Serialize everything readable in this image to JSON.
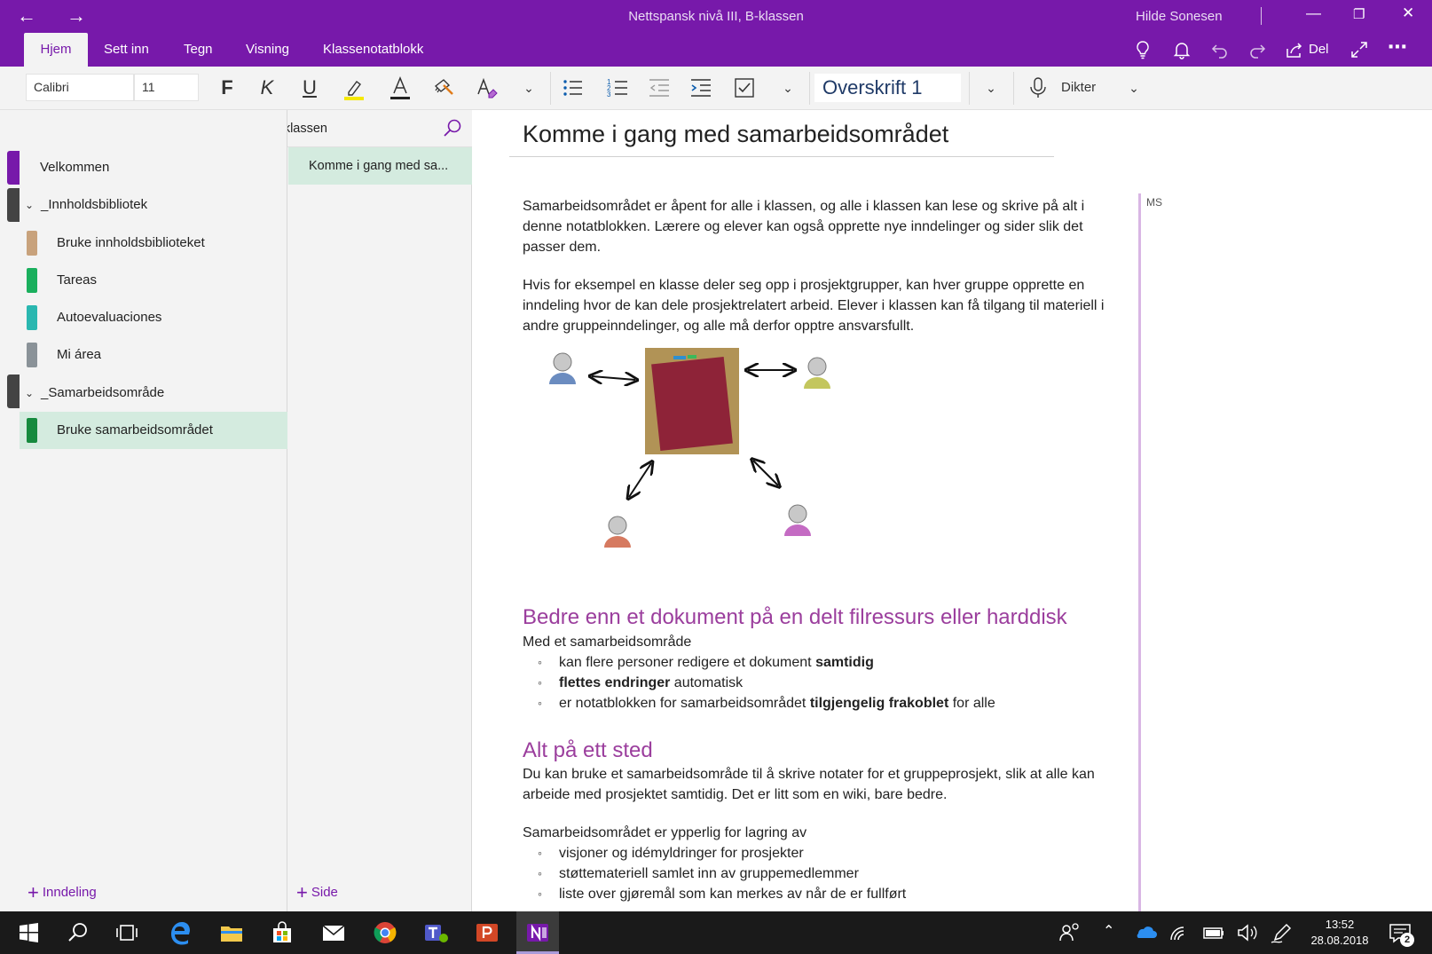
{
  "window": {
    "title": "Nettspansk nivå III, B-klassen",
    "user": "Hilde Sonesen"
  },
  "ribbon": {
    "tabs": [
      "Hjem",
      "Sett inn",
      "Tegn",
      "Visning",
      "Klassenotatblokk"
    ],
    "share_label": "Del"
  },
  "toolbar": {
    "font_family": "Calibri",
    "font_size": "11",
    "bold_label": "F",
    "italic_label": "K",
    "underline_label": "U",
    "style_value": "Overskrift 1",
    "dictate_label": "Dikter"
  },
  "notebook": {
    "name": "Nettspansk nivå III, B-klassen",
    "sections": {
      "velkommen": "Velkommen",
      "group1": "_Innholdsbibliotek",
      "s1": "Bruke innholdsbiblioteket",
      "s2": "Tareas",
      "s3": "Autoevaluaciones",
      "s4": "Mi área",
      "group2": "_Samarbeidsområde",
      "s5": "Bruke samarbeidsområdet"
    },
    "pages": [
      "Komme i gang med sa..."
    ],
    "add_section": "Inndeling",
    "add_page": "Side"
  },
  "page": {
    "title": "Komme i gang med samarbeidsområdet",
    "author_initials": "MS",
    "p1": "Samarbeidsområdet er åpent for alle i klassen, og alle i klassen kan lese og skrive på alt i denne notatblokken.  Lærere og elever kan også opprette nye inndelinger og sider slik det passer dem.",
    "p2": "Hvis for eksempel en klasse deler seg opp i prosjektgrupper, kan hver gruppe opprette en inndeling hvor de kan dele prosjektrelatert arbeid. Elever i klassen kan få tilgang til materiell i andre gruppeinndelinger, og alle må derfor opptre ansvarsfullt.",
    "h2a": "Bedre enn et dokument på en delt filressurs eller harddisk",
    "p3": "Med et samarbeidsområde",
    "b1": {
      "pre": "kan flere personer redigere et dokument ",
      "bold": "samtidig",
      "post": ""
    },
    "b2": {
      "pre": "",
      "bold": "flettes endringer",
      "post": " automatisk"
    },
    "b3": {
      "pre": "er notatblokken for samarbeidsområdet ",
      "bold": "tilgjengelig frakoblet",
      "post": " for alle"
    },
    "h2b": "Alt på ett sted",
    "p4": "Du kan bruke et samarbeidsområde til å skrive notater for et gruppeprosjekt, slik at alle kan arbeide med prosjektet samtidig. Det er litt som en wiki, bare bedre.",
    "p5": "Samarbeidsområdet er ypperlig for lagring av",
    "b4": "visjoner og idémyldringer for prosjekter",
    "b5": "støttemateriell samlet inn av gruppemedlemmer",
    "b6": "liste over gjøremål som kan merkes av når de er fullført"
  },
  "taskbar": {
    "time": "13:52",
    "date": "28.08.2018",
    "notification_count": "2"
  },
  "colors": {
    "accent": "#7719aa",
    "heading": "#9b3e9d",
    "selected": "#d4ebdf"
  }
}
